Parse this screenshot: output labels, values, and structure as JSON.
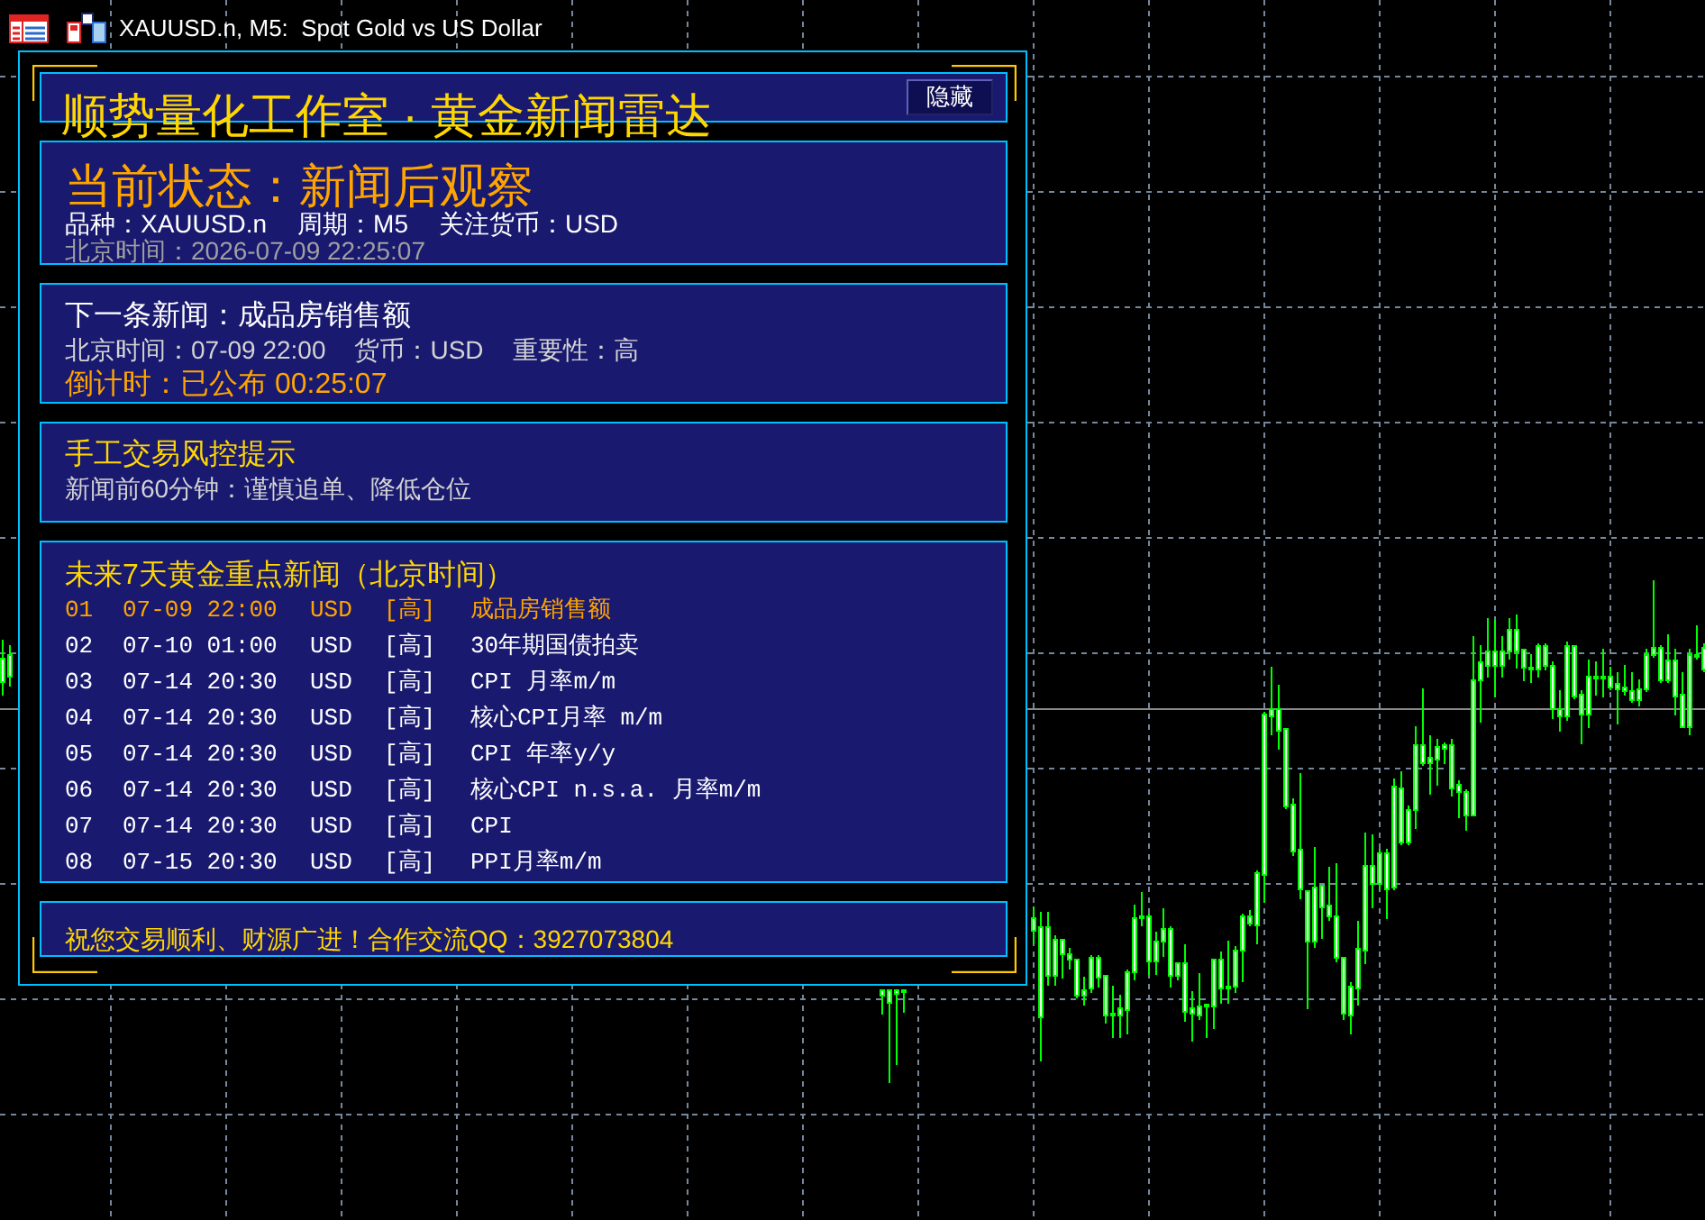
{
  "window": {
    "title": "XAUUSD.n, M5:  Spot Gold vs US Dollar"
  },
  "panel": {
    "title": "顺势量化工作室 · 黄金新闻雷达",
    "hide_button": "隐藏",
    "status": {
      "heading": "当前状态：新闻后观察",
      "details": [
        "品种：XAUUSD.n",
        "周期：M5",
        "关注货币：USD"
      ],
      "clock": "北京时间：2026-07-09 22:25:07"
    },
    "next_news": {
      "heading": "下一条新闻：成品房销售额",
      "details": [
        "北京时间：07-09 22:00",
        "货币：USD",
        "重要性：高"
      ],
      "countdown": "倒计时：已公布 00:25:07"
    },
    "risk_tip": {
      "heading": "手工交易风控提示",
      "text": "新闻前60分钟：谨慎追单、降低仓位"
    },
    "upcoming": {
      "heading": "未来7天黄金重点新闻（北京时间）",
      "rows": [
        {
          "index": "01",
          "time": "07-09 22:00",
          "currency": "USD",
          "importance": "[高]",
          "title": "成品房销售额",
          "highlighted": true
        },
        {
          "index": "02",
          "time": "07-10 01:00",
          "currency": "USD",
          "importance": "[高]",
          "title": "30年期国债拍卖",
          "highlighted": false
        },
        {
          "index": "03",
          "time": "07-14 20:30",
          "currency": "USD",
          "importance": "[高]",
          "title": "CPI 月率m/m",
          "highlighted": false
        },
        {
          "index": "04",
          "time": "07-14 20:30",
          "currency": "USD",
          "importance": "[高]",
          "title": "核心CPI月率 m/m",
          "highlighted": false
        },
        {
          "index": "05",
          "time": "07-14 20:30",
          "currency": "USD",
          "importance": "[高]",
          "title": "CPI 年率y/y",
          "highlighted": false
        },
        {
          "index": "06",
          "time": "07-14 20:30",
          "currency": "USD",
          "importance": "[高]",
          "title": "核心CPI n.s.a. 月率m/m",
          "highlighted": false
        },
        {
          "index": "07",
          "time": "07-14 20:30",
          "currency": "USD",
          "importance": "[高]",
          "title": "CPI",
          "highlighted": false
        },
        {
          "index": "08",
          "time": "07-15 20:30",
          "currency": "USD",
          "importance": "[高]",
          "title": "PPI月率m/m",
          "highlighted": false
        }
      ]
    },
    "footer": "祝您交易顺利、财源广进！合作交流QQ：3927073804"
  }
}
